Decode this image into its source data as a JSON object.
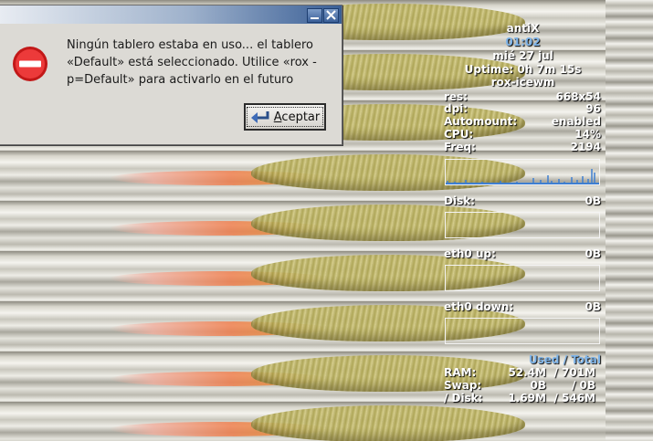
{
  "dialog": {
    "message": "Ningún tablero estaba en uso... el tablero «Default» está seleccionado. Utilice «rox -p=Default» para activarlo en el futuro",
    "ok_label": "Aceptar",
    "icon": "stop-icon",
    "buttons": {
      "minimize": "minimize-icon",
      "close": "close-icon"
    }
  },
  "conky": {
    "hostname": "antiX",
    "clock": "01:02",
    "date": "mié 27 jul",
    "uptime": "Uptime: 0h 7m 15s",
    "session": "rox-icewm",
    "rows": [
      {
        "label": "res:",
        "value": "668x54"
      },
      {
        "label": "dpi:",
        "value": "96"
      },
      {
        "label": "Automount:",
        "value": "enabled"
      },
      {
        "label": "CPU:",
        "value": "14%"
      },
      {
        "label": "Freq:",
        "value": "2194"
      }
    ],
    "graphs": {
      "disk": {
        "label": "Disk:",
        "value": "0B"
      },
      "eth0_up": {
        "label": "eth0 up:",
        "value": "0B"
      },
      "eth0_down": {
        "label": "eth0 down:",
        "value": "0B"
      }
    },
    "mem_header": "Used / Total",
    "ram": {
      "label": "RAM:",
      "used": "52.4M",
      "total": "/ 701M"
    },
    "swap": {
      "label": "Swap:",
      "used": "0B",
      "total": "/ 0B"
    },
    "rootdisk": {
      "label": "/ Disk:",
      "used": "1.69M",
      "total": "/ 546M"
    },
    "accent": "#7fb4e8"
  }
}
